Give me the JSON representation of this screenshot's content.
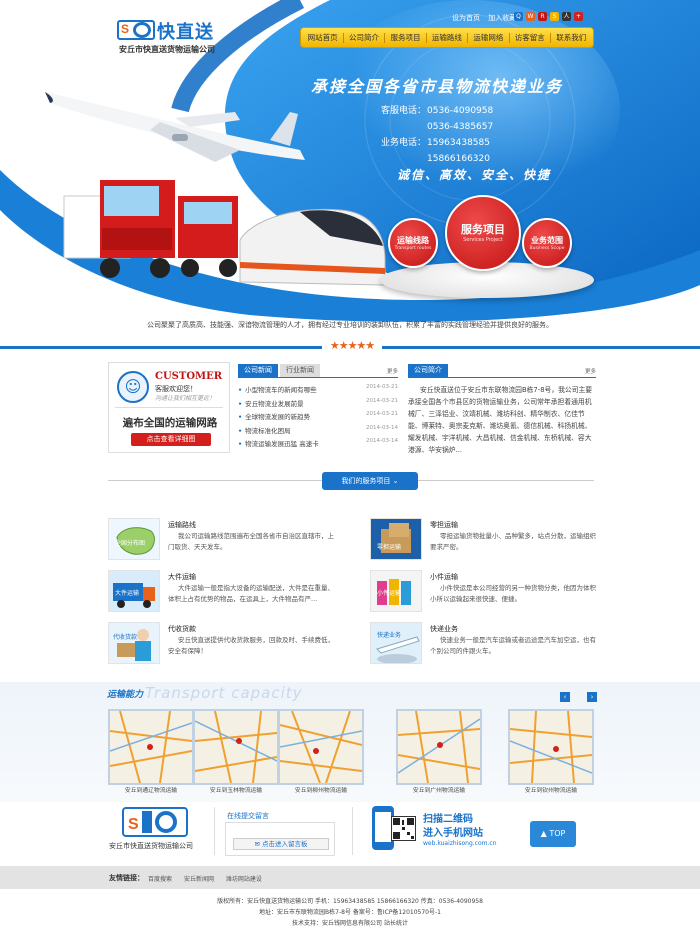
{
  "header": {
    "logo_title": "快直送",
    "logo_subtitle": "安丘市快直送货物运输公司",
    "top_links": [
      "设为首页",
      "加入收藏"
    ],
    "nav": [
      "网站首页",
      "公司简介",
      "服务项目",
      "运输路线",
      "运输网络",
      "访客留言",
      "联系我们"
    ]
  },
  "banner": {
    "slogan": "承接全国各省市县物流快递业务",
    "contacts": [
      {
        "label": "客服电话：",
        "value": "0536-4090958"
      },
      {
        "label": "",
        "value": "0536-4385657"
      },
      {
        "label": "业务电话：",
        "value": "15963438585"
      },
      {
        "label": "",
        "value": "15866166320"
      }
    ],
    "motto": "诚信、高效、安全、快捷",
    "circles": [
      {
        "title": "运输线路",
        "en": "Transport routes"
      },
      {
        "title": "服务项目",
        "en": "Services Project"
      },
      {
        "title": "业务范围",
        "en": "Business Scope"
      }
    ],
    "intro": "公司聚聚了高质高、技能强、深谙物流管理的人才，拥有经过专业培训的装卸队伍，积累了丰富的实践管理经验并提供良好的服务。"
  },
  "customer": {
    "title": "CUSTOMER",
    "line1": "客服欢迎您！",
    "line2": "沟通让我们相互更近！",
    "network": "遍布全国的运输网路",
    "button": "点击查看详细图"
  },
  "news": {
    "tabs": [
      "公司新闻",
      "行业新闻"
    ],
    "more": "更多",
    "items": [
      {
        "title": "小型物流车的新闻有哪些",
        "date": "2014-03-21"
      },
      {
        "title": "安丘物流业发展前景",
        "date": "2014-03-21"
      },
      {
        "title": "全球物流发展的新趋势",
        "date": "2014-03-21"
      },
      {
        "title": "物流标准化困局",
        "date": "2014-03-14"
      },
      {
        "title": "物流运输发展迅猛 高速卡",
        "date": "2014-03-14"
      }
    ]
  },
  "about": {
    "tab": "公司简介",
    "more": "更多",
    "text": "安丘快直送位于安丘市东联物流园B栋7-8号，我公司主要承接全国各个市县区的货物运输业务，公司常年承担着通用机械厂、三泽铝业、汶靖机械、潍坊科创、精华制衣、亿佳节能、博莱特、奥宗麦克斯、潍坊奥氰、德信机械、科扬机械、耀发机械、宇洋机械、大昌机械、信金机械、东桥机械、容大港源、华安锅炉..."
  },
  "services_button": "我们的服务项目",
  "services": [
    {
      "title": "运输路线",
      "text": "我公司运输路线范围遍布全国各省市自治区直辖市，上门取货、天天发车。",
      "img": "全国分布图"
    },
    {
      "title": "零担运输",
      "text": "零担运输货物批量小、品种繁多，站点分散，运输组织要求严密。",
      "img": "零担运输"
    },
    {
      "title": "大件运输",
      "text": "大件运输一般是指大设备的运输配送，大件是在重量、体积上占有优势的物品，在运具上，大件物品有严...",
      "img": "大件运输"
    },
    {
      "title": "小件运输",
      "text": "小件快运是本公司经营的另一种货物分类，他因为体积小所以运输起来很快速、便捷。",
      "img": "小件运输"
    },
    {
      "title": "代收货款",
      "text": "安丘快直送提供代收货款服务，回款及时、手续费低，安全有保障！",
      "img": "代收货款"
    },
    {
      "title": "快递业务",
      "text": "快速业务一般是汽车运输或者远途是汽车加空运，也有个别公司的件跟火车。",
      "img": "快递业务"
    }
  ],
  "capacity": {
    "title": "运输能力",
    "title_en": "Transport capacity",
    "maps": [
      "安丘到通辽物流运输",
      "安丘到玉林物流运输",
      "安丘到柳州物流运输",
      "安丘到广州物流运输",
      "安丘到钦州物流运输"
    ]
  },
  "footer": {
    "company": "安丘市快直送货物运输公司",
    "message_title": "在线提交留言",
    "message_button": "点击进入留言板",
    "scan1": "扫描二维码",
    "scan2": "进入手机网站",
    "scan3": "web.kuaizhisong.com.cn",
    "top": "TOP",
    "links_label": "友情链接：",
    "links": [
      "百度搜索",
      "安丘新闻网",
      "潍坊网站建设"
    ],
    "lines": [
      "版权所有：安丘快直送货物运输公司    手机：15963438585   15866166320   传真：0536-4090958",
      "地址：安丘市东联物流园B栋7-8号    备案号：鲁ICP备12010570号-1",
      "技术支持：安丘钱网信息有限公司    站长统计"
    ]
  }
}
